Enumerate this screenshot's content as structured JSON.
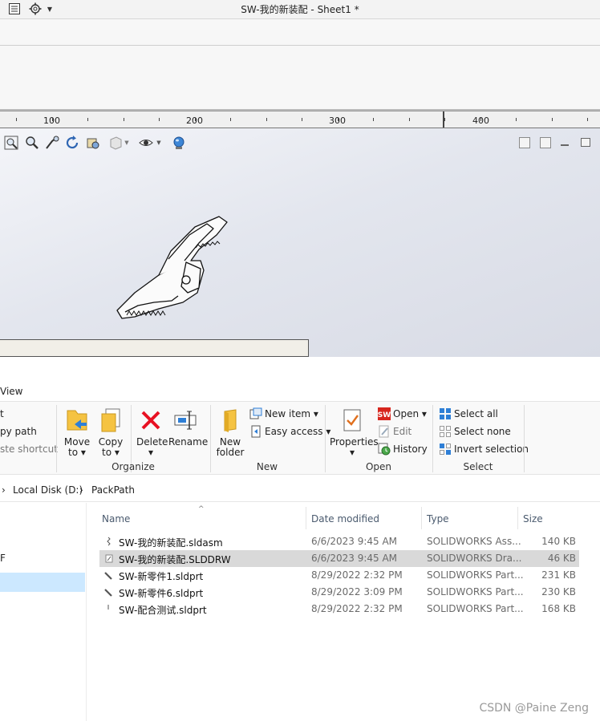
{
  "sw": {
    "window_title": "SW-我的新装配 - Sheet1 *",
    "ruler": [
      "100",
      "200",
      "300",
      "400"
    ]
  },
  "explorer": {
    "tab_fragment": "View",
    "ribbon": {
      "clipboard": {
        "cut": "t",
        "copy_path": "py path",
        "paste_shortcut": "ste shortcut"
      },
      "organize": {
        "label": "Organize",
        "move_to": "Move to ▾",
        "copy_to": "Copy to ▾",
        "delete": "Delete ▾",
        "rename": "Rename"
      },
      "new": {
        "label": "New",
        "new_folder": "New folder",
        "new_item": "New item ▾",
        "easy_access": "Easy access ▾"
      },
      "open": {
        "label": "Open",
        "properties": "Properties ▾",
        "open": "Open ▾",
        "edit": "Edit",
        "history": "History"
      },
      "select": {
        "label": "Select",
        "select_all": "Select all",
        "select_none": "Select none",
        "invert": "Invert selection"
      }
    },
    "address": {
      "sep1": "›",
      "crumb1": "Local Disk (D:)",
      "sep2": "›",
      "crumb2": "PackPath"
    },
    "nav_fragment": "F",
    "columns": {
      "name": "Name",
      "date": "Date modified",
      "type": "Type",
      "size": "Size"
    },
    "files": [
      {
        "name": "SW-我的新装配.sldasm",
        "date": "6/6/2023 9:45 AM",
        "type": "SOLIDWORKS Ass...",
        "size": "140 KB",
        "selected": false
      },
      {
        "name": "SW-我的新装配.SLDDRW",
        "date": "6/6/2023 9:45 AM",
        "type": "SOLIDWORKS Dra...",
        "size": "46 KB",
        "selected": true
      },
      {
        "name": "SW-新零件1.sldprt",
        "date": "8/29/2022 2:32 PM",
        "type": "SOLIDWORKS Part...",
        "size": "231 KB",
        "selected": false
      },
      {
        "name": "SW-新零件6.sldprt",
        "date": "8/29/2022 3:09 PM",
        "type": "SOLIDWORKS Part...",
        "size": "230 KB",
        "selected": false
      },
      {
        "name": "SW-配合测试.sldprt",
        "date": "8/29/2022 2:32 PM",
        "type": "SOLIDWORKS Part...",
        "size": "168 KB",
        "selected": false
      }
    ]
  },
  "watermark": "CSDN @Paine Zeng",
  "colors": {
    "selection": "#cce8ff",
    "row_selected": "#d9d9d9",
    "delete_red": "#e81123",
    "folder_yellow": "#f5c342",
    "sw_red": "#d7261e"
  }
}
